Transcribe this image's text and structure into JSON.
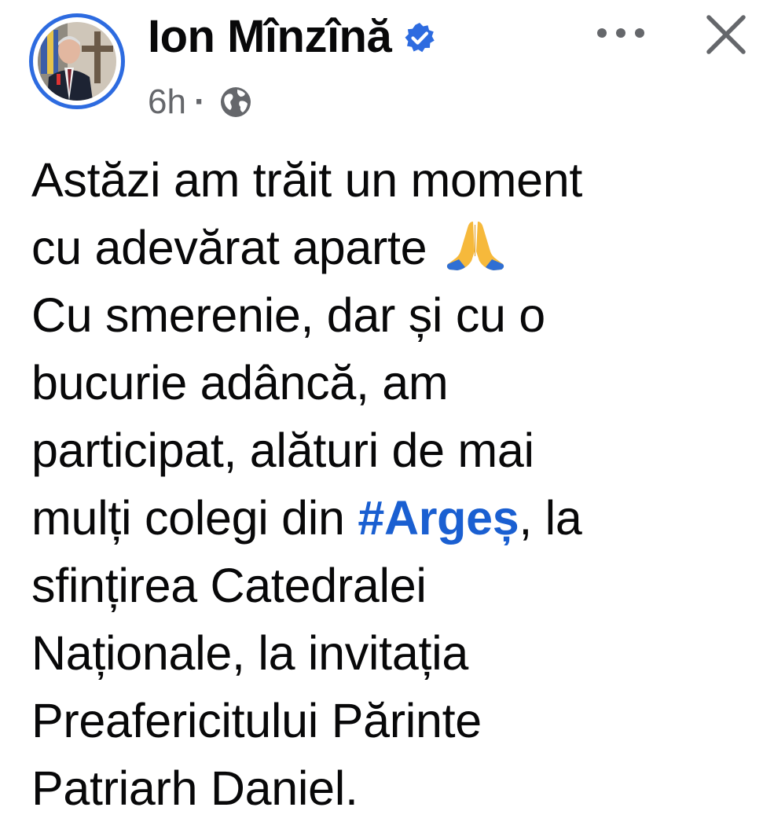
{
  "post": {
    "author": "Ion Mînzînă",
    "time": "6h",
    "separator": "·",
    "audience_icon": "globe-icon",
    "verified_icon": "verified-badge-icon",
    "more_icon": "more-options-icon",
    "close_icon": "close-icon",
    "body": {
      "line1": "Astăzi am trăit un moment",
      "line2": "cu adevărat aparte",
      "line2_emoji": "praying-hands-emoji",
      "line3": "Cu smerenie, dar și cu o",
      "line4": "bucurie adâncă, am",
      "line5": "participat, alături de mai",
      "line6_pre": "mulți colegi din ",
      "line6_hashtag": "#Argeș",
      "line6_post": ", la",
      "line7": "sfințirea Catedralei",
      "line8": "Naționale, la invitația",
      "line9": "Preafericitului Părinte",
      "line10": "Patriarh Daniel."
    }
  },
  "colors": {
    "text": "#080809",
    "meta": "#65676b",
    "accent_blue": "#2d6be0",
    "hashtag": "#1a5fd1"
  }
}
